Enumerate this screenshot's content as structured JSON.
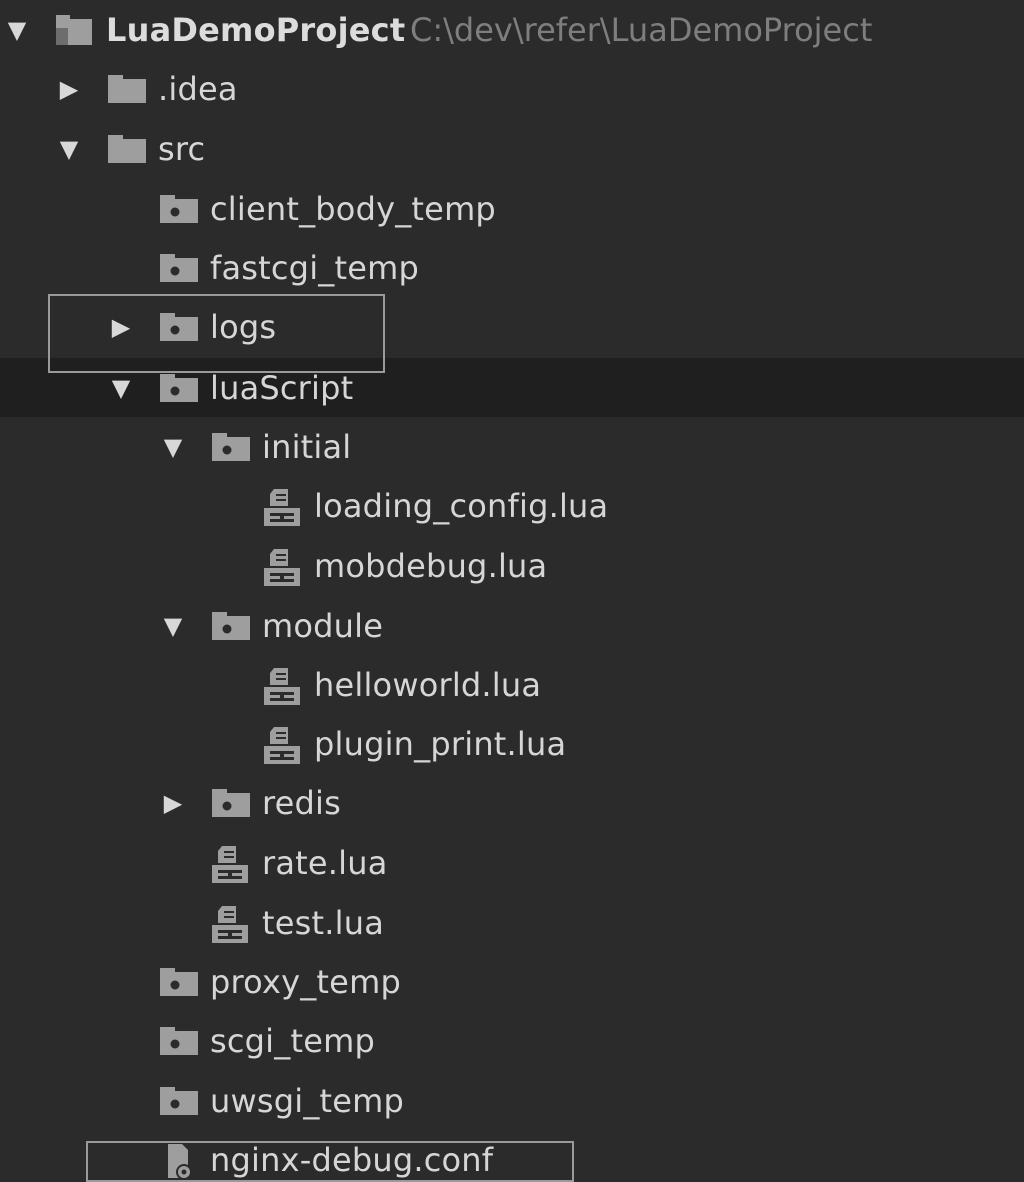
{
  "project": {
    "name": "LuaDemoProject",
    "path": "C:\\dev\\refer\\LuaDemoProject"
  },
  "tree": [
    {
      "label": "LuaDemoProject",
      "kind": "project",
      "arrow": "expanded",
      "depth": 0,
      "icon": "project-folder-icon"
    },
    {
      "label": ".idea",
      "kind": "folder",
      "arrow": "collapsed",
      "depth": 1,
      "icon": "folder-icon"
    },
    {
      "label": "src",
      "kind": "folder",
      "arrow": "expanded",
      "depth": 1,
      "icon": "folder-icon"
    },
    {
      "label": "client_body_temp",
      "kind": "folder-dot",
      "arrow": "none",
      "depth": 2,
      "icon": "folder-icon"
    },
    {
      "label": "fastcgi_temp",
      "kind": "folder-dot",
      "arrow": "none",
      "depth": 2,
      "icon": "folder-icon"
    },
    {
      "label": "logs",
      "kind": "folder-dot",
      "arrow": "collapsed",
      "depth": 2,
      "icon": "folder-icon",
      "highlighted": true
    },
    {
      "label": "luaScript",
      "kind": "folder-dot",
      "arrow": "expanded",
      "depth": 2,
      "icon": "folder-icon",
      "selected": true
    },
    {
      "label": "initial",
      "kind": "folder-dot",
      "arrow": "expanded",
      "depth": 3,
      "icon": "folder-icon"
    },
    {
      "label": "loading_config.lua",
      "kind": "lua-file",
      "arrow": "none",
      "depth": 4,
      "icon": "lua-file-icon"
    },
    {
      "label": "mobdebug.lua",
      "kind": "lua-file",
      "arrow": "none",
      "depth": 4,
      "icon": "lua-file-icon"
    },
    {
      "label": "module",
      "kind": "folder-dot",
      "arrow": "expanded",
      "depth": 3,
      "icon": "folder-icon"
    },
    {
      "label": "helloworld.lua",
      "kind": "lua-file",
      "arrow": "none",
      "depth": 4,
      "icon": "lua-file-icon"
    },
    {
      "label": "plugin_print.lua",
      "kind": "lua-file",
      "arrow": "none",
      "depth": 4,
      "icon": "lua-file-icon"
    },
    {
      "label": "redis",
      "kind": "folder-dot",
      "arrow": "collapsed",
      "depth": 3,
      "icon": "folder-icon"
    },
    {
      "label": "rate.lua",
      "kind": "lua-file",
      "arrow": "none",
      "depth": 3,
      "icon": "lua-file-icon"
    },
    {
      "label": "test.lua",
      "kind": "lua-file",
      "arrow": "none",
      "depth": 3,
      "icon": "lua-file-icon"
    },
    {
      "label": "proxy_temp",
      "kind": "folder-dot",
      "arrow": "none",
      "depth": 2,
      "icon": "folder-icon"
    },
    {
      "label": "scgi_temp",
      "kind": "folder-dot",
      "arrow": "none",
      "depth": 2,
      "icon": "folder-icon"
    },
    {
      "label": "uwsgi_temp",
      "kind": "folder-dot",
      "arrow": "none",
      "depth": 2,
      "icon": "folder-icon"
    },
    {
      "label": "nginx-debug.conf",
      "kind": "conf-file",
      "arrow": "none",
      "depth": 2,
      "icon": "config-file-icon",
      "highlighted": true
    }
  ],
  "colors": {
    "background": "#2b2b2b",
    "selected_row": "#1f1f1f",
    "text": "#d6d6d6",
    "path_text": "#7e7e7e",
    "icon": "#9e9e9e",
    "highlight_border": "#9a9a9a"
  }
}
